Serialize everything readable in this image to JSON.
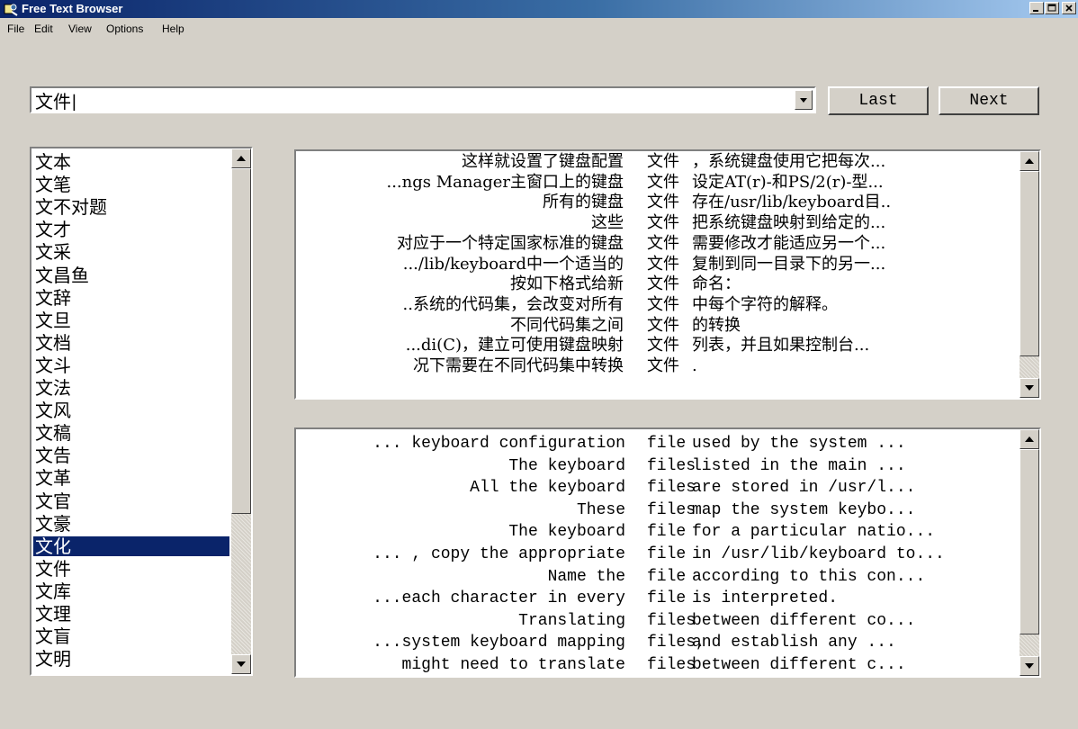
{
  "window": {
    "title": "Free Text Browser",
    "app_icon": "app-icon"
  },
  "menu": [
    "File",
    "Edit",
    "View",
    "Options",
    "Help"
  ],
  "search": {
    "value": "文件|",
    "last_label": "Last",
    "next_label": "Next"
  },
  "word_list": {
    "selected_index": 17,
    "items": [
      "文本",
      "文笔",
      "文不对题",
      "文才",
      "文采",
      "文昌鱼",
      "文辞",
      "文旦",
      "文档",
      "文斗",
      "文法",
      "文风",
      "文稿",
      "文告",
      "文革",
      "文官",
      "文豪",
      "文化",
      "文件",
      "文库",
      "文理",
      "文盲",
      "文明"
    ]
  },
  "chinese_concordance": {
    "keyword": "文件",
    "rows": [
      {
        "left": "这样就设置了键盘配置",
        "right": "，系统键盘使用它把每次..."
      },
      {
        "left": "...ngs Manager主窗口上的键盘",
        "right": "设定AT(r)-和PS/2(r)-型..."
      },
      {
        "left": "所有的键盘",
        "right": "存在/usr/lib/keyboard目.."
      },
      {
        "left": "这些",
        "right": "把系统键盘映射到给定的..."
      },
      {
        "left": "对应于一个特定国家标准的键盘",
        "right": "需要修改才能适应另一个..."
      },
      {
        "left": ".../lib/keyboard中一个适当的",
        "right": "复制到同一目录下的另一..."
      },
      {
        "left": "按如下格式给新",
        "right": "命名："
      },
      {
        "left": "..系统的代码集，会改变对所有",
        "right": "中每个字符的解释。"
      },
      {
        "left": "不同代码集之间",
        "right": "的转换"
      },
      {
        "left": "...di(C)，建立可使用键盘映射",
        "right": "列表，并且如果控制台..."
      },
      {
        "left": "况下需要在不同代码集中转换",
        "right": "."
      }
    ]
  },
  "english_concordance": {
    "rows": [
      {
        "left": "... keyboard configuration",
        "kw": "file",
        "right": "used by the system ..."
      },
      {
        "left": "The keyboard",
        "kw": "files",
        "right": "listed in the main ..."
      },
      {
        "left": "All the keyboard",
        "kw": "files",
        "right": "are stored in /usr/l..."
      },
      {
        "left": "These",
        "kw": "files",
        "right": "map the system keybo..."
      },
      {
        "left": "The keyboard",
        "kw": "file",
        "right": "for a particular natio..."
      },
      {
        "left": "... , copy the appropriate",
        "kw": "file",
        "right": "in /usr/lib/keyboard to..."
      },
      {
        "left": "Name the",
        "kw": "file",
        "right": "according to this con..."
      },
      {
        "left": "...each character in every",
        "kw": "file",
        "right": "is interpreted."
      },
      {
        "left": "Translating",
        "kw": "files",
        "right": "between different co..."
      },
      {
        "left": "...system keyboard mapping",
        "kw": "files,",
        "right": "and establish any ..."
      },
      {
        "left": "might need to translate",
        "kw": "files",
        "right": "between different c..."
      }
    ]
  }
}
